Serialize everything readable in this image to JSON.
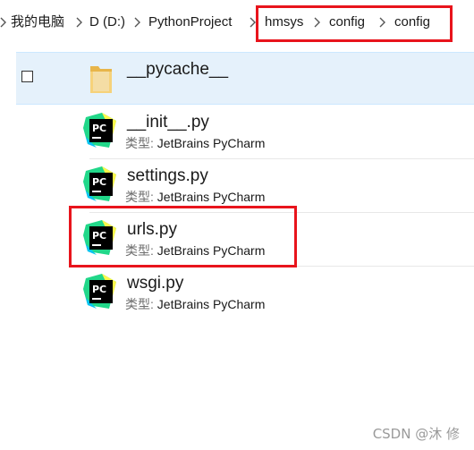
{
  "breadcrumb": {
    "items": [
      "我的电脑",
      "D (D:)",
      "PythonProject",
      "hmsys",
      "config",
      "config"
    ]
  },
  "files": [
    {
      "name": "__pycache__",
      "type_label": "",
      "type_value": "",
      "icon": "folder-icon",
      "selected": true
    },
    {
      "name": "__init__.py",
      "type_label": "类型: ",
      "type_value": "JetBrains PyCharm",
      "icon": "pycharm-icon"
    },
    {
      "name": "settings.py",
      "type_label": "类型: ",
      "type_value": "JetBrains PyCharm",
      "icon": "pycharm-icon"
    },
    {
      "name": "urls.py",
      "type_label": "类型: ",
      "type_value": "JetBrains PyCharm",
      "icon": "pycharm-icon"
    },
    {
      "name": "wsgi.py",
      "type_label": "类型: ",
      "type_value": "JetBrains PyCharm",
      "icon": "pycharm-icon"
    }
  ],
  "pycharm_icon_text": "PC",
  "watermark": "CSDN @沐 修",
  "colors": {
    "highlight": "#e8141c",
    "selection": "#e5f1fb",
    "folder": "#f2c55c"
  }
}
